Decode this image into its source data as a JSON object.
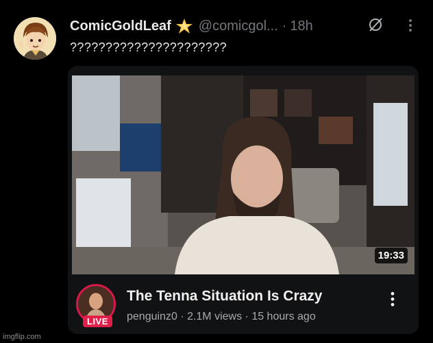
{
  "tweet": {
    "display_name": "ComicGoldLeaf",
    "handle": "@comicgol...",
    "separator": "·",
    "time": "18h",
    "text": "??????????????????????",
    "verified_icon": "star-badge-icon"
  },
  "card": {
    "duration": "19:33",
    "title": "The Tenna Situation Is Crazy",
    "channel": "penguinz0",
    "views": "2.1M views",
    "age": "15 hours ago",
    "live_label": "LIVE",
    "meta_sep": " · "
  },
  "watermark": "imgflip.com",
  "colors": {
    "background": "#000000",
    "muted": "#71767b",
    "live": "#e01f4b"
  }
}
